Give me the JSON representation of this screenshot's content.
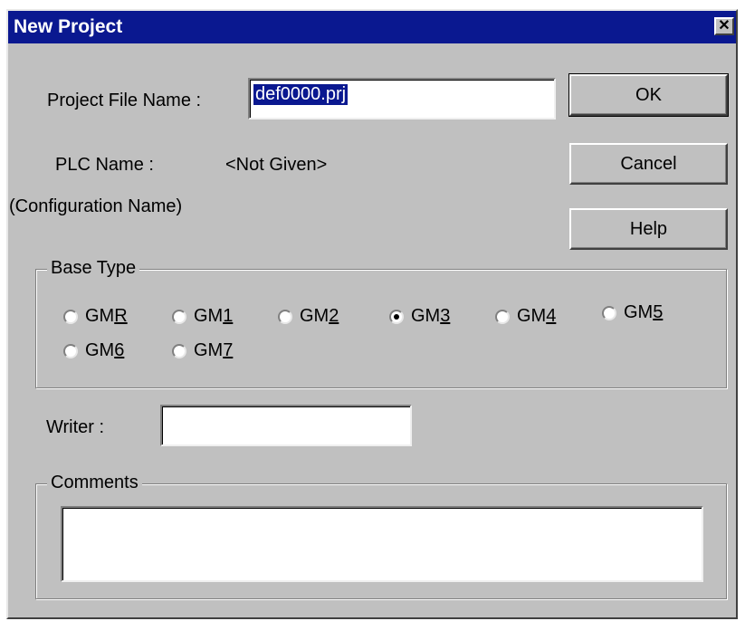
{
  "window": {
    "title": "New Project",
    "close_glyph": "✕"
  },
  "project_file": {
    "label": "Project File Name :",
    "value": "def0000.prj"
  },
  "plc": {
    "label": "PLC Name :",
    "value": "<Not Given>",
    "sub_label": "(Configuration Name)"
  },
  "buttons": {
    "ok": "OK",
    "cancel": "Cancel",
    "help": "Help"
  },
  "base_type": {
    "legend": "Base Type",
    "selected": "GM3",
    "options": [
      {
        "prefix": "GM",
        "accel": "R",
        "checked": false
      },
      {
        "prefix": "GM",
        "accel": "1",
        "checked": false
      },
      {
        "prefix": "GM",
        "accel": "2",
        "checked": false
      },
      {
        "prefix": "GM",
        "accel": "3",
        "checked": true
      },
      {
        "prefix": "GM",
        "accel": "4",
        "checked": false
      },
      {
        "prefix": "GM",
        "accel": "5",
        "checked": false
      },
      {
        "prefix": "GM",
        "accel": "6",
        "checked": false
      },
      {
        "prefix": "GM",
        "accel": "7",
        "checked": false
      }
    ]
  },
  "writer": {
    "label": "Writer :",
    "value": ""
  },
  "comments": {
    "legend": "Comments",
    "value": ""
  },
  "colors": {
    "titlebar": "#0a1890",
    "face": "#c0c0c0",
    "selection": "#0a1890"
  }
}
